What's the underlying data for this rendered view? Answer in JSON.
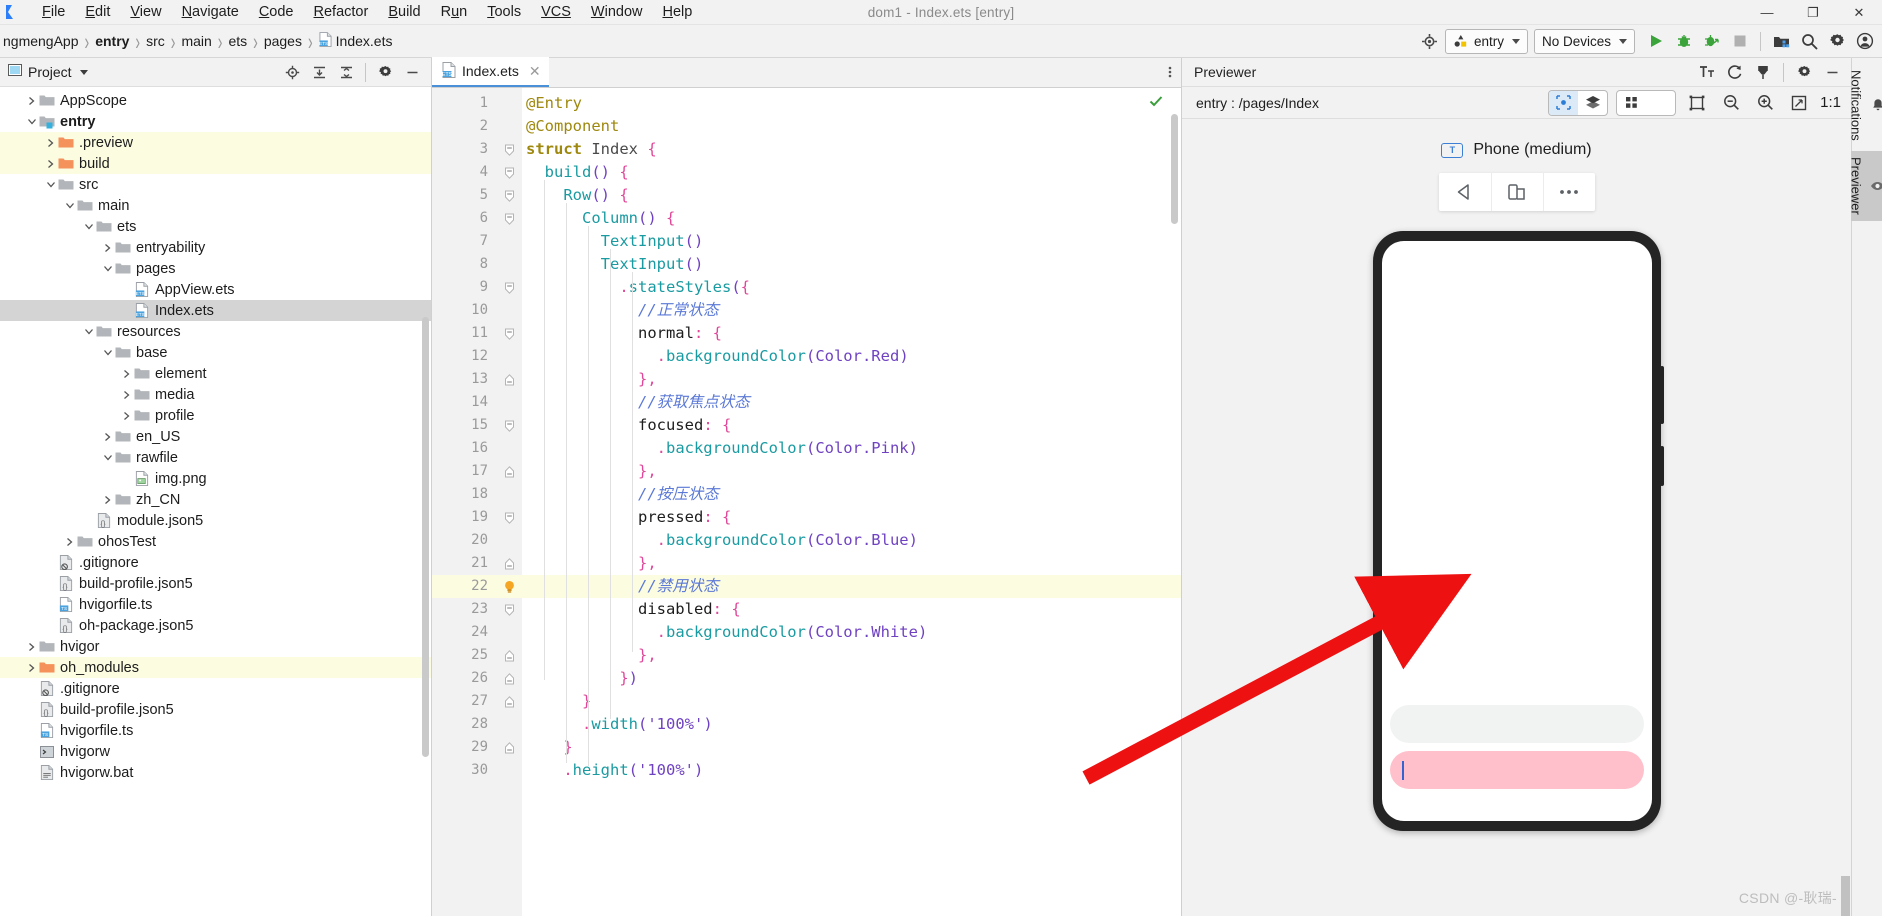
{
  "window": {
    "title": "dom1 - Index.ets [entry]",
    "minimize": "—",
    "maximize": "❐",
    "close": "✕"
  },
  "menu": {
    "items": [
      {
        "mnemonic": "F",
        "rest": "ile"
      },
      {
        "mnemonic": "E",
        "rest": "dit"
      },
      {
        "mnemonic": "V",
        "rest": "iew"
      },
      {
        "mnemonic": "N",
        "rest": "avigate"
      },
      {
        "mnemonic": "C",
        "rest": "ode"
      },
      {
        "mnemonic": "R",
        "rest": "efactor"
      },
      {
        "mnemonic": "B",
        "rest": "uild"
      },
      {
        "mnemonic": "R",
        "rest": "un",
        "pre": "R",
        "alt": true
      },
      {
        "mnemonic": "T",
        "rest": "ools"
      },
      {
        "mnemonic": "VCS",
        "rest": ""
      },
      {
        "mnemonic": "W",
        "rest": "indow"
      },
      {
        "mnemonic": "H",
        "rest": "elp"
      }
    ],
    "labels": [
      "File",
      "Edit",
      "View",
      "Navigate",
      "Code",
      "Refactor",
      "Build",
      "Run",
      "Tools",
      "VCS",
      "Window",
      "Help"
    ]
  },
  "breadcrumb": {
    "items": [
      "ngmengApp",
      "entry",
      "src",
      "main",
      "ets",
      "pages",
      "Index.ets"
    ],
    "bold_index": 1,
    "last_icon": "ets-file-icon"
  },
  "toolbar": {
    "target_device_icon": "device-target-icon",
    "module_selector": "entry",
    "device_selector": "No Devices",
    "run_label": "run-button",
    "debug_label": "debug-button",
    "profile_label": "profile-button",
    "stop_label": "stop-button",
    "device_manager_label": "device-manager-button",
    "search_label": "search-everywhere-button",
    "settings_label": "settings-button",
    "account_label": "account-button"
  },
  "project_panel": {
    "title": "Project",
    "tree": [
      {
        "label": "AppScope",
        "indent": 1,
        "arrow": "right",
        "icon": "folder-gray",
        "state": "none"
      },
      {
        "label": "entry",
        "indent": 1,
        "arrow": "down",
        "icon": "folder-module",
        "state": "none",
        "bold": true
      },
      {
        "label": ".preview",
        "indent": 2,
        "arrow": "right",
        "icon": "folder-orange",
        "state": "yellow"
      },
      {
        "label": "build",
        "indent": 2,
        "arrow": "right",
        "icon": "folder-orange",
        "state": "yellow"
      },
      {
        "label": "src",
        "indent": 2,
        "arrow": "down",
        "icon": "folder-gray",
        "state": "none"
      },
      {
        "label": "main",
        "indent": 3,
        "arrow": "down",
        "icon": "folder-gray",
        "state": "none"
      },
      {
        "label": "ets",
        "indent": 4,
        "arrow": "down",
        "icon": "folder-gray",
        "state": "none"
      },
      {
        "label": "entryability",
        "indent": 5,
        "arrow": "right",
        "icon": "folder-gray",
        "state": "none"
      },
      {
        "label": "pages",
        "indent": 5,
        "arrow": "down",
        "icon": "folder-gray",
        "state": "none"
      },
      {
        "label": "AppView.ets",
        "indent": 6,
        "arrow": "none",
        "icon": "ets-file",
        "state": "none"
      },
      {
        "label": "Index.ets",
        "indent": 6,
        "arrow": "none",
        "icon": "ets-file",
        "state": "selected"
      },
      {
        "label": "resources",
        "indent": 4,
        "arrow": "down",
        "icon": "folder-gray",
        "state": "none"
      },
      {
        "label": "base",
        "indent": 5,
        "arrow": "down",
        "icon": "folder-gray",
        "state": "none"
      },
      {
        "label": "element",
        "indent": 6,
        "arrow": "right",
        "icon": "folder-gray",
        "state": "none"
      },
      {
        "label": "media",
        "indent": 6,
        "arrow": "right",
        "icon": "folder-gray",
        "state": "none"
      },
      {
        "label": "profile",
        "indent": 6,
        "arrow": "right",
        "icon": "folder-gray",
        "state": "none"
      },
      {
        "label": "en_US",
        "indent": 5,
        "arrow": "right",
        "icon": "folder-gray",
        "state": "none"
      },
      {
        "label": "rawfile",
        "indent": 5,
        "arrow": "down",
        "icon": "folder-gray",
        "state": "none"
      },
      {
        "label": "img.png",
        "indent": 6,
        "arrow": "none",
        "icon": "image-file",
        "state": "none"
      },
      {
        "label": "zh_CN",
        "indent": 5,
        "arrow": "right",
        "icon": "folder-gray",
        "state": "none"
      },
      {
        "label": "module.json5",
        "indent": 4,
        "arrow": "none",
        "icon": "json5-file",
        "state": "none"
      },
      {
        "label": "ohosTest",
        "indent": 3,
        "arrow": "right",
        "icon": "folder-gray",
        "state": "none"
      },
      {
        "label": ".gitignore",
        "indent": 2,
        "arrow": "none",
        "icon": "gitignore-file",
        "state": "none"
      },
      {
        "label": "build-profile.json5",
        "indent": 2,
        "arrow": "none",
        "icon": "json5-file",
        "state": "none"
      },
      {
        "label": "hvigorfile.ts",
        "indent": 2,
        "arrow": "none",
        "icon": "ts-file",
        "state": "none"
      },
      {
        "label": "oh-package.json5",
        "indent": 2,
        "arrow": "none",
        "icon": "json5-file",
        "state": "none"
      },
      {
        "label": "hvigor",
        "indent": 1,
        "arrow": "right",
        "icon": "folder-gray",
        "state": "none"
      },
      {
        "label": "oh_modules",
        "indent": 1,
        "arrow": "right",
        "icon": "folder-orange",
        "state": "yellow"
      },
      {
        "label": ".gitignore",
        "indent": 1,
        "arrow": "none",
        "icon": "gitignore-file",
        "state": "none"
      },
      {
        "label": "build-profile.json5",
        "indent": 1,
        "arrow": "none",
        "icon": "json5-file",
        "state": "none"
      },
      {
        "label": "hvigorfile.ts",
        "indent": 1,
        "arrow": "none",
        "icon": "ts-file",
        "state": "none"
      },
      {
        "label": "hvigorw",
        "indent": 1,
        "arrow": "none",
        "icon": "shell-file",
        "state": "none"
      },
      {
        "label": "hvigorw.bat",
        "indent": 1,
        "arrow": "none",
        "icon": "bat-file",
        "state": "none"
      }
    ]
  },
  "editor": {
    "tab_label": "Index.ets",
    "tab_close": "✕",
    "status_ok_icon": "inspection-ok-check",
    "current_line": 22,
    "lines": [
      {
        "n": 1,
        "fold": "none",
        "tokens": [
          {
            "t": "@Entry",
            "c": "kw-ann"
          }
        ],
        "indent": 0
      },
      {
        "n": 2,
        "fold": "none",
        "tokens": [
          {
            "t": "@Component",
            "c": "kw-ann"
          }
        ],
        "indent": 0
      },
      {
        "n": 3,
        "fold": "open",
        "tokens": [
          {
            "t": "struct ",
            "c": "kw-struct"
          },
          {
            "t": "Index",
            "c": "id-type"
          },
          {
            "t": " {",
            "c": "brace"
          }
        ],
        "indent": 0
      },
      {
        "n": 4,
        "fold": "open",
        "tokens": [
          {
            "t": "  build",
            "c": "fn"
          },
          {
            "t": "()",
            "c": "paren"
          },
          {
            "t": " {",
            "c": "brace"
          }
        ],
        "indent": 1
      },
      {
        "n": 5,
        "fold": "open",
        "tokens": [
          {
            "t": "    Row",
            "c": "fn"
          },
          {
            "t": "()",
            "c": "paren"
          },
          {
            "t": " {",
            "c": "brace"
          }
        ],
        "indent": 2
      },
      {
        "n": 6,
        "fold": "open",
        "tokens": [
          {
            "t": "      Column",
            "c": "fn"
          },
          {
            "t": "()",
            "c": "paren"
          },
          {
            "t": " {",
            "c": "brace"
          }
        ],
        "indent": 3
      },
      {
        "n": 7,
        "fold": "none",
        "tokens": [
          {
            "t": "        TextInput",
            "c": "fn"
          },
          {
            "t": "()",
            "c": "paren"
          }
        ],
        "indent": 4
      },
      {
        "n": 8,
        "fold": "none",
        "tokens": [
          {
            "t": "        TextInput",
            "c": "fn"
          },
          {
            "t": "()",
            "c": "paren"
          }
        ],
        "indent": 4
      },
      {
        "n": 9,
        "fold": "open",
        "tokens": [
          {
            "t": "          .",
            "c": "brace"
          },
          {
            "t": "stateStyles",
            "c": "method"
          },
          {
            "t": "(",
            "c": "paren"
          },
          {
            "t": "{",
            "c": "brace"
          }
        ],
        "indent": 5
      },
      {
        "n": 10,
        "fold": "none",
        "tokens": [
          {
            "t": "            //正常状态",
            "c": "comment"
          }
        ],
        "indent": 6
      },
      {
        "n": 11,
        "fold": "open",
        "tokens": [
          {
            "t": "            normal",
            "c": "prop"
          },
          {
            "t": ":",
            "c": "brace"
          },
          {
            "t": " {",
            "c": "brace"
          }
        ],
        "indent": 6
      },
      {
        "n": 12,
        "fold": "none",
        "tokens": [
          {
            "t": "              .",
            "c": "brace"
          },
          {
            "t": "backgroundColor",
            "c": "method"
          },
          {
            "t": "(",
            "c": "paren"
          },
          {
            "t": "Color.Red",
            "c": "enumv"
          },
          {
            "t": ")",
            "c": "paren"
          }
        ],
        "indent": 7
      },
      {
        "n": 13,
        "fold": "close",
        "tokens": [
          {
            "t": "            },",
            "c": "brace"
          }
        ],
        "indent": 6
      },
      {
        "n": 14,
        "fold": "none",
        "tokens": [
          {
            "t": "            //获取焦点状态",
            "c": "comment"
          }
        ],
        "indent": 6
      },
      {
        "n": 15,
        "fold": "open",
        "tokens": [
          {
            "t": "            focused",
            "c": "prop"
          },
          {
            "t": ":",
            "c": "brace"
          },
          {
            "t": " {",
            "c": "brace"
          }
        ],
        "indent": 6
      },
      {
        "n": 16,
        "fold": "none",
        "tokens": [
          {
            "t": "              .",
            "c": "brace"
          },
          {
            "t": "backgroundColor",
            "c": "method"
          },
          {
            "t": "(",
            "c": "paren"
          },
          {
            "t": "Color.Pink",
            "c": "enumv"
          },
          {
            "t": ")",
            "c": "paren"
          }
        ],
        "indent": 7
      },
      {
        "n": 17,
        "fold": "close",
        "tokens": [
          {
            "t": "            },",
            "c": "brace"
          }
        ],
        "indent": 6
      },
      {
        "n": 18,
        "fold": "none",
        "tokens": [
          {
            "t": "            //按压状态",
            "c": "comment"
          }
        ],
        "indent": 6
      },
      {
        "n": 19,
        "fold": "open",
        "tokens": [
          {
            "t": "            pressed",
            "c": "prop"
          },
          {
            "t": ":",
            "c": "brace"
          },
          {
            "t": " {",
            "c": "brace"
          }
        ],
        "indent": 6
      },
      {
        "n": 20,
        "fold": "none",
        "tokens": [
          {
            "t": "              .",
            "c": "brace"
          },
          {
            "t": "backgroundColor",
            "c": "method"
          },
          {
            "t": "(",
            "c": "paren"
          },
          {
            "t": "Color.Blue",
            "c": "enumv"
          },
          {
            "t": ")",
            "c": "paren"
          }
        ],
        "indent": 7
      },
      {
        "n": 21,
        "fold": "close",
        "tokens": [
          {
            "t": "            },",
            "c": "brace"
          }
        ],
        "indent": 6
      },
      {
        "n": 22,
        "fold": "bulb",
        "tokens": [
          {
            "t": "            //禁用状态",
            "c": "comment"
          }
        ],
        "indent": 6
      },
      {
        "n": 23,
        "fold": "open",
        "tokens": [
          {
            "t": "            disabled",
            "c": "prop"
          },
          {
            "t": ":",
            "c": "brace"
          },
          {
            "t": " {",
            "c": "brace"
          }
        ],
        "indent": 6
      },
      {
        "n": 24,
        "fold": "none",
        "tokens": [
          {
            "t": "              .",
            "c": "brace"
          },
          {
            "t": "backgroundColor",
            "c": "method"
          },
          {
            "t": "(",
            "c": "paren"
          },
          {
            "t": "Color.White",
            "c": "enumv"
          },
          {
            "t": ")",
            "c": "paren"
          }
        ],
        "indent": 7
      },
      {
        "n": 25,
        "fold": "close",
        "tokens": [
          {
            "t": "            },",
            "c": "brace"
          }
        ],
        "indent": 6
      },
      {
        "n": 26,
        "fold": "close",
        "tokens": [
          {
            "t": "          }",
            "c": "brace"
          },
          {
            "t": ")",
            "c": "paren"
          }
        ],
        "indent": 5
      },
      {
        "n": 27,
        "fold": "close",
        "tokens": [
          {
            "t": "      }",
            "c": "brace"
          }
        ],
        "indent": 3
      },
      {
        "n": 28,
        "fold": "none",
        "tokens": [
          {
            "t": "      .",
            "c": "brace"
          },
          {
            "t": "width",
            "c": "method"
          },
          {
            "t": "(",
            "c": "paren"
          },
          {
            "t": "'100%'",
            "c": "str"
          },
          {
            "t": ")",
            "c": "paren"
          }
        ],
        "indent": 3
      },
      {
        "n": 29,
        "fold": "close",
        "tokens": [
          {
            "t": "    }",
            "c": "brace"
          }
        ],
        "indent": 2
      },
      {
        "n": 30,
        "fold": "none",
        "tokens": [
          {
            "t": "    .",
            "c": "brace"
          },
          {
            "t": "height",
            "c": "method"
          },
          {
            "t": "(",
            "c": "paren"
          },
          {
            "t": "'100%'",
            "c": "str"
          },
          {
            "t": ")",
            "c": "paren"
          }
        ],
        "indent": 2
      }
    ]
  },
  "previewer": {
    "title": "Previewer",
    "route": "entry : /pages/Index",
    "device_label": "Phone (medium)",
    "device_chip_text": "T",
    "zoom_ratio": "1:1",
    "tools": {
      "font_size_icon": "font-size-icon",
      "refresh_icon": "refresh-icon",
      "plugin_icon": "plug-icon",
      "settings_icon": "gear-icon",
      "minimize_icon": "minimize-icon",
      "inspector_icon": "inspector-icon",
      "layers_icon": "layers-icon",
      "multi_device_icon": "grid-icon",
      "multi_device_caret": "chevron-down-icon",
      "fit_icon": "fit-frame-icon",
      "zoom_out_icon": "zoom-out-icon",
      "zoom_in_icon": "zoom-in-icon",
      "actual_size_icon": "actual-size-icon",
      "rotate_icon": "rotate-icon",
      "fold_icon": "fold-device-icon",
      "more_icon": "more-icon"
    },
    "preview_inputs": [
      {
        "name": "text-input-normal",
        "state": "normal",
        "color": "#f1f3f2",
        "has_caret": false
      },
      {
        "name": "text-input-focused",
        "state": "focused",
        "color": "#ffc0cb",
        "has_caret": true
      }
    ]
  },
  "right_rail": {
    "tabs": [
      {
        "label": "Notifications",
        "icon": "bell-icon",
        "active": false
      },
      {
        "label": "Previewer",
        "icon": "eye-icon",
        "active": true
      }
    ]
  },
  "annotation": {
    "arrow_color": "#ee1111",
    "arrow_name": "red-pointer-arrow"
  },
  "watermark": "CSDN @-耿瑞-"
}
